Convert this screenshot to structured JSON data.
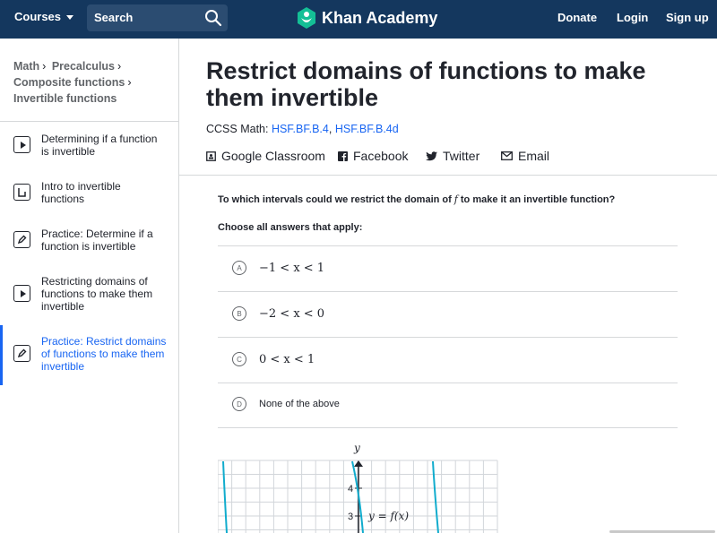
{
  "header": {
    "courses_label": "Courses",
    "search_label": "Search",
    "logo_text": "Khan Academy",
    "donate_label": "Donate",
    "login_label": "Login",
    "signup_label": "Sign up",
    "brand_color": "#14375e",
    "accent_color": "#1865f2"
  },
  "breadcrumbs": {
    "math": "Math",
    "precalculus": "Precalculus",
    "composite": "Composite functions",
    "invertible": "Invertible functions"
  },
  "sidebar": {
    "items": [
      {
        "label": "Determining if a function is invertible",
        "icon": "play-icon"
      },
      {
        "label": "Intro to invertible functions",
        "icon": "article-icon"
      },
      {
        "label": "Practice: Determine if a function is invertible",
        "icon": "pencil-icon"
      },
      {
        "label": "Restricting domains of functions to make them invertible",
        "icon": "play-icon"
      },
      {
        "label": "Practice: Restrict domains of functions to make them invertible",
        "icon": "pencil-icon"
      }
    ]
  },
  "main": {
    "title": "Restrict domains of functions to make them invertible",
    "ccss_prefix": "CCSS Math: ",
    "std1": "HSF.BF.B.4",
    "std_sep": ",",
    "std2": "HSF.BF.B.4d",
    "share": {
      "google": "Google Classroom",
      "facebook": "Facebook",
      "twitter": "Twitter",
      "email": "Email"
    }
  },
  "exercise": {
    "question_pre": "To which intervals could we restrict the domain of",
    "question_var": "f",
    "question_post": "to make it an invertible function?",
    "instruction": "Choose all answers that apply:",
    "options": [
      {
        "letter": "A",
        "text": "−1 < x < 1"
      },
      {
        "letter": "B",
        "text": "−2 < x < 0"
      },
      {
        "letter": "C",
        "text": "0 < x < 1"
      },
      {
        "letter": "D",
        "text": "None of the above"
      }
    ],
    "graph": {
      "y_axis_label": "y",
      "tick_4": "4",
      "tick_3": "3",
      "curve_label": "y = f(x)",
      "curve_color": "#11accd"
    }
  }
}
